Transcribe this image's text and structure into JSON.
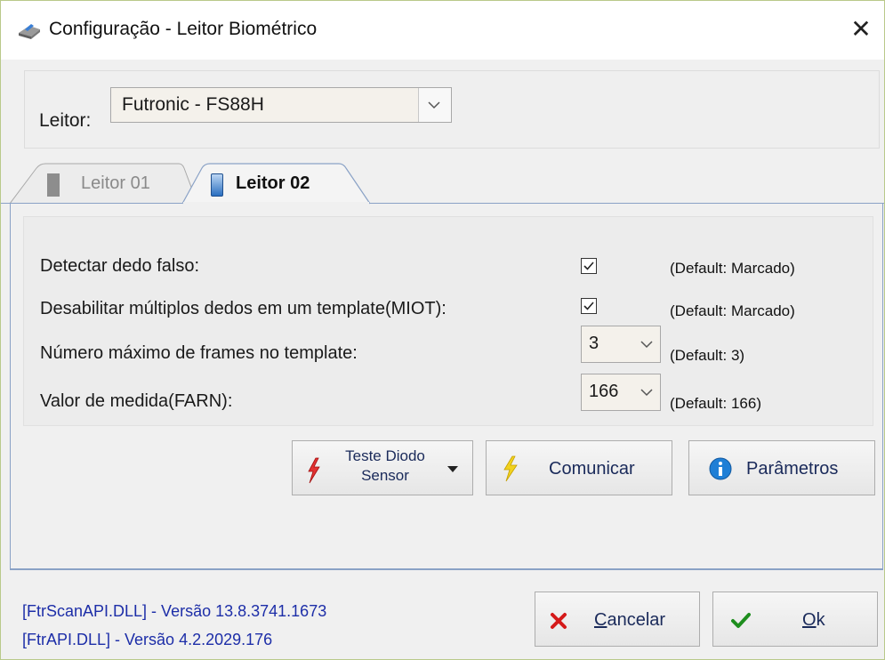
{
  "window": {
    "title": "Configuração - Leitor Biométrico",
    "close_glyph": "✕"
  },
  "reader": {
    "label": "Leitor:",
    "selected": "Futronic - FS88H"
  },
  "tabs": [
    {
      "label": "Leitor 01",
      "active": false
    },
    {
      "label": "Leitor 02",
      "active": true
    }
  ],
  "settings": {
    "fake_finger": {
      "label": "Detectar dedo falso:",
      "checked": true,
      "default": "(Default: Marcado)"
    },
    "multi_finger": {
      "label": "Desabilitar múltiplos dedos em um template(MIOT):",
      "checked": true,
      "default": "(Default: Marcado)"
    },
    "max_frames": {
      "label": "Número máximo de frames no template:",
      "value": "3",
      "default": "(Default: 3)"
    },
    "farn": {
      "label": "Valor de medida(FARN):",
      "value": "166",
      "default": "(Default: 166)"
    }
  },
  "actions": {
    "test_diode_line1": "Teste Diodo",
    "test_diode_line2": "Sensor",
    "communicate": "Comunicar",
    "parameters": "Parâmetros"
  },
  "footer": {
    "version1": "[FtrScanAPI.DLL] - Versão 13.8.3741.1673",
    "version2": "[FtrAPI.DLL] - Versão 4.2.2029.176",
    "cancel_first": "C",
    "cancel_rest": "ancelar",
    "ok_first": "O",
    "ok_rest": "k"
  },
  "icons": {
    "app": "biometric-reader-icon",
    "close": "close-icon",
    "dropdown": "chevron-down-icon",
    "tab1": "reader-device-gray-icon",
    "tab2": "reader-device-blue-icon",
    "checkbox": "checkmark-icon",
    "test": "red-lightning-icon",
    "split": "caret-down-icon",
    "communicate": "yellow-lightning-icon",
    "parameters": "info-icon",
    "cancel": "red-x-icon",
    "ok": "green-check-icon"
  },
  "colors": {
    "link_blue": "#1d2ea8",
    "tab_border": "#8aa2c6",
    "cancel_red": "#d51a1a",
    "ok_green": "#1e8e1e",
    "info_blue": "#1f7fd6"
  }
}
